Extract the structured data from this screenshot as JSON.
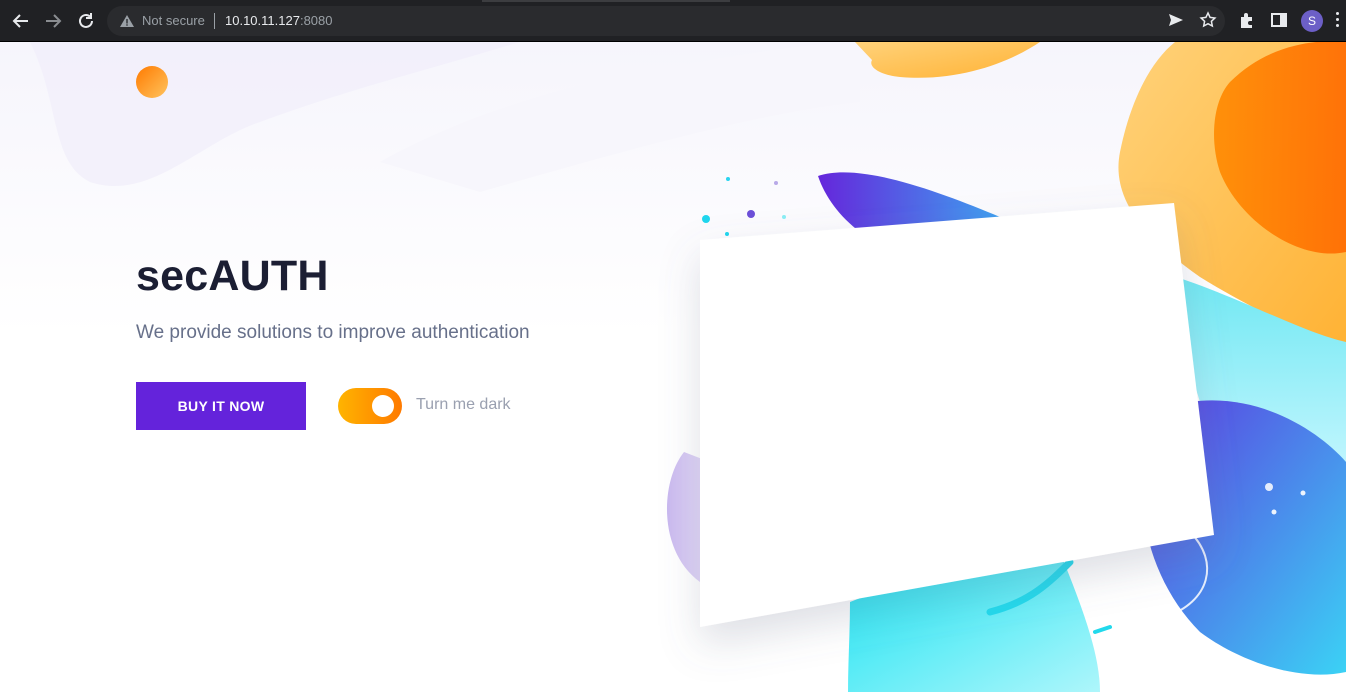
{
  "browser": {
    "security_label": "Not secure",
    "url_host": "10.10.11.127",
    "url_port": ":8080",
    "profile_initial": "S",
    "icons": [
      "back-icon",
      "forward-icon",
      "reload-icon",
      "warning-icon",
      "send-icon",
      "star-icon",
      "extensions-icon",
      "sidebar-icon",
      "menu-icon"
    ]
  },
  "page": {
    "title": "secAUTH",
    "subtitle": "We provide solutions to improve authentication",
    "buy_label": "BUY IT NOW",
    "toggle_label": "Turn me dark",
    "toggle_on": true,
    "colors": {
      "accent": "#6423db",
      "title": "#1b1e33",
      "toggle_from": "#ffb400",
      "toggle_to": "#ff7a00"
    }
  }
}
